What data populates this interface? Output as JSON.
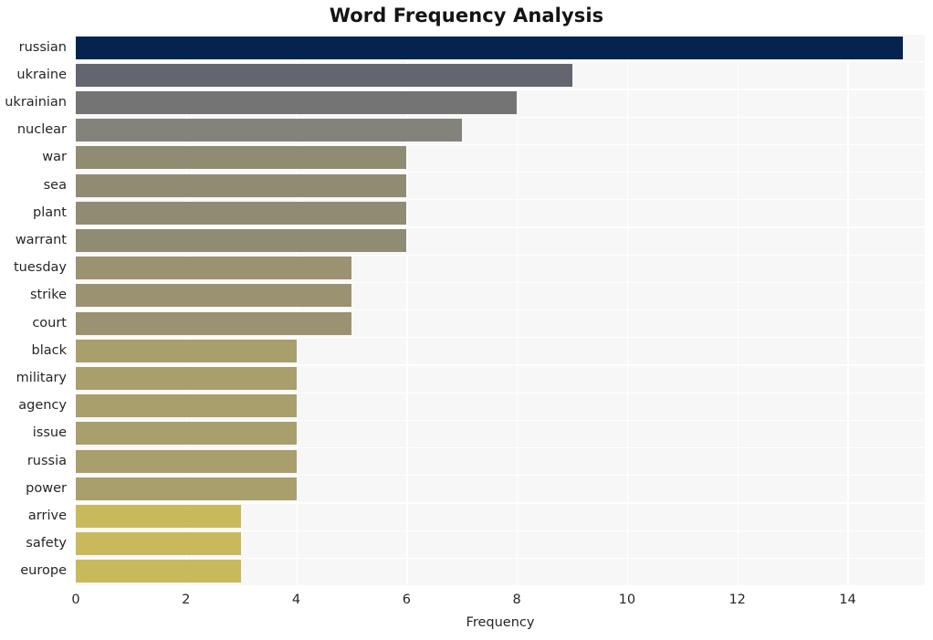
{
  "chart_data": {
    "type": "bar",
    "orientation": "horizontal",
    "title": "Word Frequency Analysis",
    "xlabel": "Frequency",
    "ylabel": "",
    "xlim": [
      0,
      15.4
    ],
    "ylim": [
      0,
      20
    ],
    "grid": true,
    "legend": null,
    "background": "#f7f7f7",
    "xticks": [
      0,
      2,
      4,
      6,
      8,
      10,
      12,
      14
    ],
    "xtick_labels": [
      "0",
      "2",
      "4",
      "6",
      "8",
      "10",
      "12",
      "14"
    ],
    "categories": [
      "russian",
      "ukraine",
      "ukrainian",
      "nuclear",
      "war",
      "sea",
      "plant",
      "warrant",
      "tuesday",
      "strike",
      "court",
      "black",
      "military",
      "agency",
      "issue",
      "russia",
      "power",
      "arrive",
      "safety",
      "europe"
    ],
    "values": [
      15,
      9,
      8,
      7,
      6,
      6,
      6,
      6,
      5,
      5,
      5,
      4,
      4,
      4,
      4,
      4,
      4,
      3,
      3,
      3
    ],
    "bar_colors": [
      "#05234f",
      "#63656f",
      "#747474",
      "#83827b",
      "#908c74",
      "#908c74",
      "#908c74",
      "#908c74",
      "#9a9270",
      "#9a9270",
      "#9a9270",
      "#a99f6c",
      "#a99f6c",
      "#a99f6c",
      "#a99f6c",
      "#a99f6c",
      "#a99f6c",
      "#c8b95d",
      "#c8b95d",
      "#c8b95d"
    ]
  }
}
